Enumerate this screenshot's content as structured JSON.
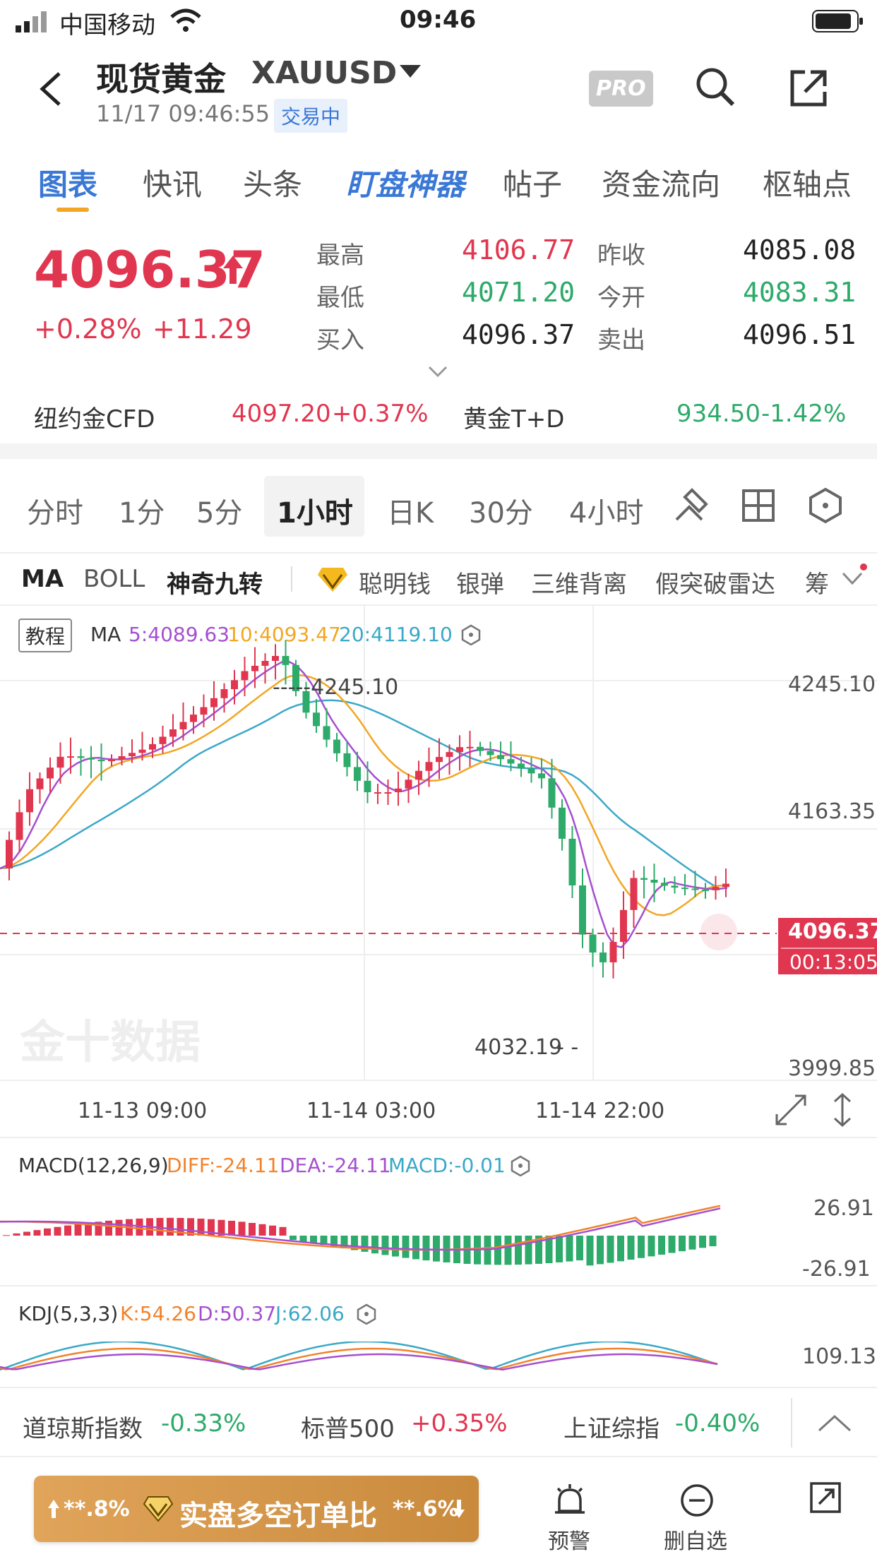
{
  "status": {
    "carrier": "中国移动",
    "time": "09:46"
  },
  "header": {
    "title": "现货黄金",
    "ticker": "XAUUSD",
    "datetime": "11/17 09:46:55",
    "trade_status": "交易中",
    "pro": "PRO"
  },
  "tabs": [
    "图表",
    "快讯",
    "头条",
    "盯盘神器",
    "帖子",
    "资金流向",
    "枢轴点"
  ],
  "quote": {
    "price": "4096.37",
    "pct": "+0.28%",
    "change": "+11.29",
    "high_l": "最高",
    "high": "4106.77",
    "low_l": "最低",
    "low": "4071.20",
    "buy_l": "买入",
    "buy": "4096.37",
    "prev_l": "昨收",
    "prev": "4085.08",
    "open_l": "今开",
    "open": "4083.31",
    "sell_l": "卖出",
    "sell": "4096.51"
  },
  "related": {
    "a_name": "纽约金CFD",
    "a_val": "4097.20",
    "a_pct": "+0.37%",
    "b_name": "黄金T+D",
    "b_val": "934.50",
    "b_pct": "-1.42%"
  },
  "periods": [
    "分时",
    "1分",
    "5分",
    "1小时",
    "日K",
    "30分",
    "4小时"
  ],
  "indicators": [
    "MA",
    "BOLL",
    "神奇九转",
    "聪明钱",
    "银弹",
    "三维背离",
    "假突破雷达",
    "筹"
  ],
  "chart_labels": {
    "tutorial": "教程",
    "ma": "MA",
    "ma5": "5:4089.63",
    "ma10": "10:4093.47",
    "ma20": "20:4119.10",
    "y1": "4245.10",
    "y2": "4163.35",
    "y3": "3999.85",
    "high_mark": "4245.10",
    "low_mark": "4032.19",
    "cur_price": "4096.37",
    "countdown": "00:13:05",
    "watermark": "金十数据",
    "x1": "11-13 09:00",
    "x2": "11-14 03:00",
    "x3": "11-14 22:00"
  },
  "macd": {
    "label": "MACD(12,26,9)",
    "diff": "DIFF:-24.11",
    "dea": "DEA:-24.11",
    "macd": "MACD:-0.01",
    "top": "26.91",
    "bot": "-26.91"
  },
  "kdj": {
    "label": "KDJ(5,3,3)",
    "k": "K:54.26",
    "d": "D:50.37",
    "j": "J:62.06",
    "top": "109.13"
  },
  "indices": {
    "a": "道琼斯指数",
    "a_v": "-0.33%",
    "b": "标普500",
    "b_v": "+0.35%",
    "c": "上证综指",
    "c_v": "-0.40%"
  },
  "bar": {
    "left": "**.8%",
    "mid": "实盘多空订单比",
    "right": "**.6%",
    "alert": "预警",
    "del": "删自选"
  },
  "chart_data": {
    "type": "candlestick",
    "last": 4096.37,
    "high": 4245.1,
    "low": 4032.19,
    "ylim": [
      3999.85,
      4245.1
    ]
  }
}
